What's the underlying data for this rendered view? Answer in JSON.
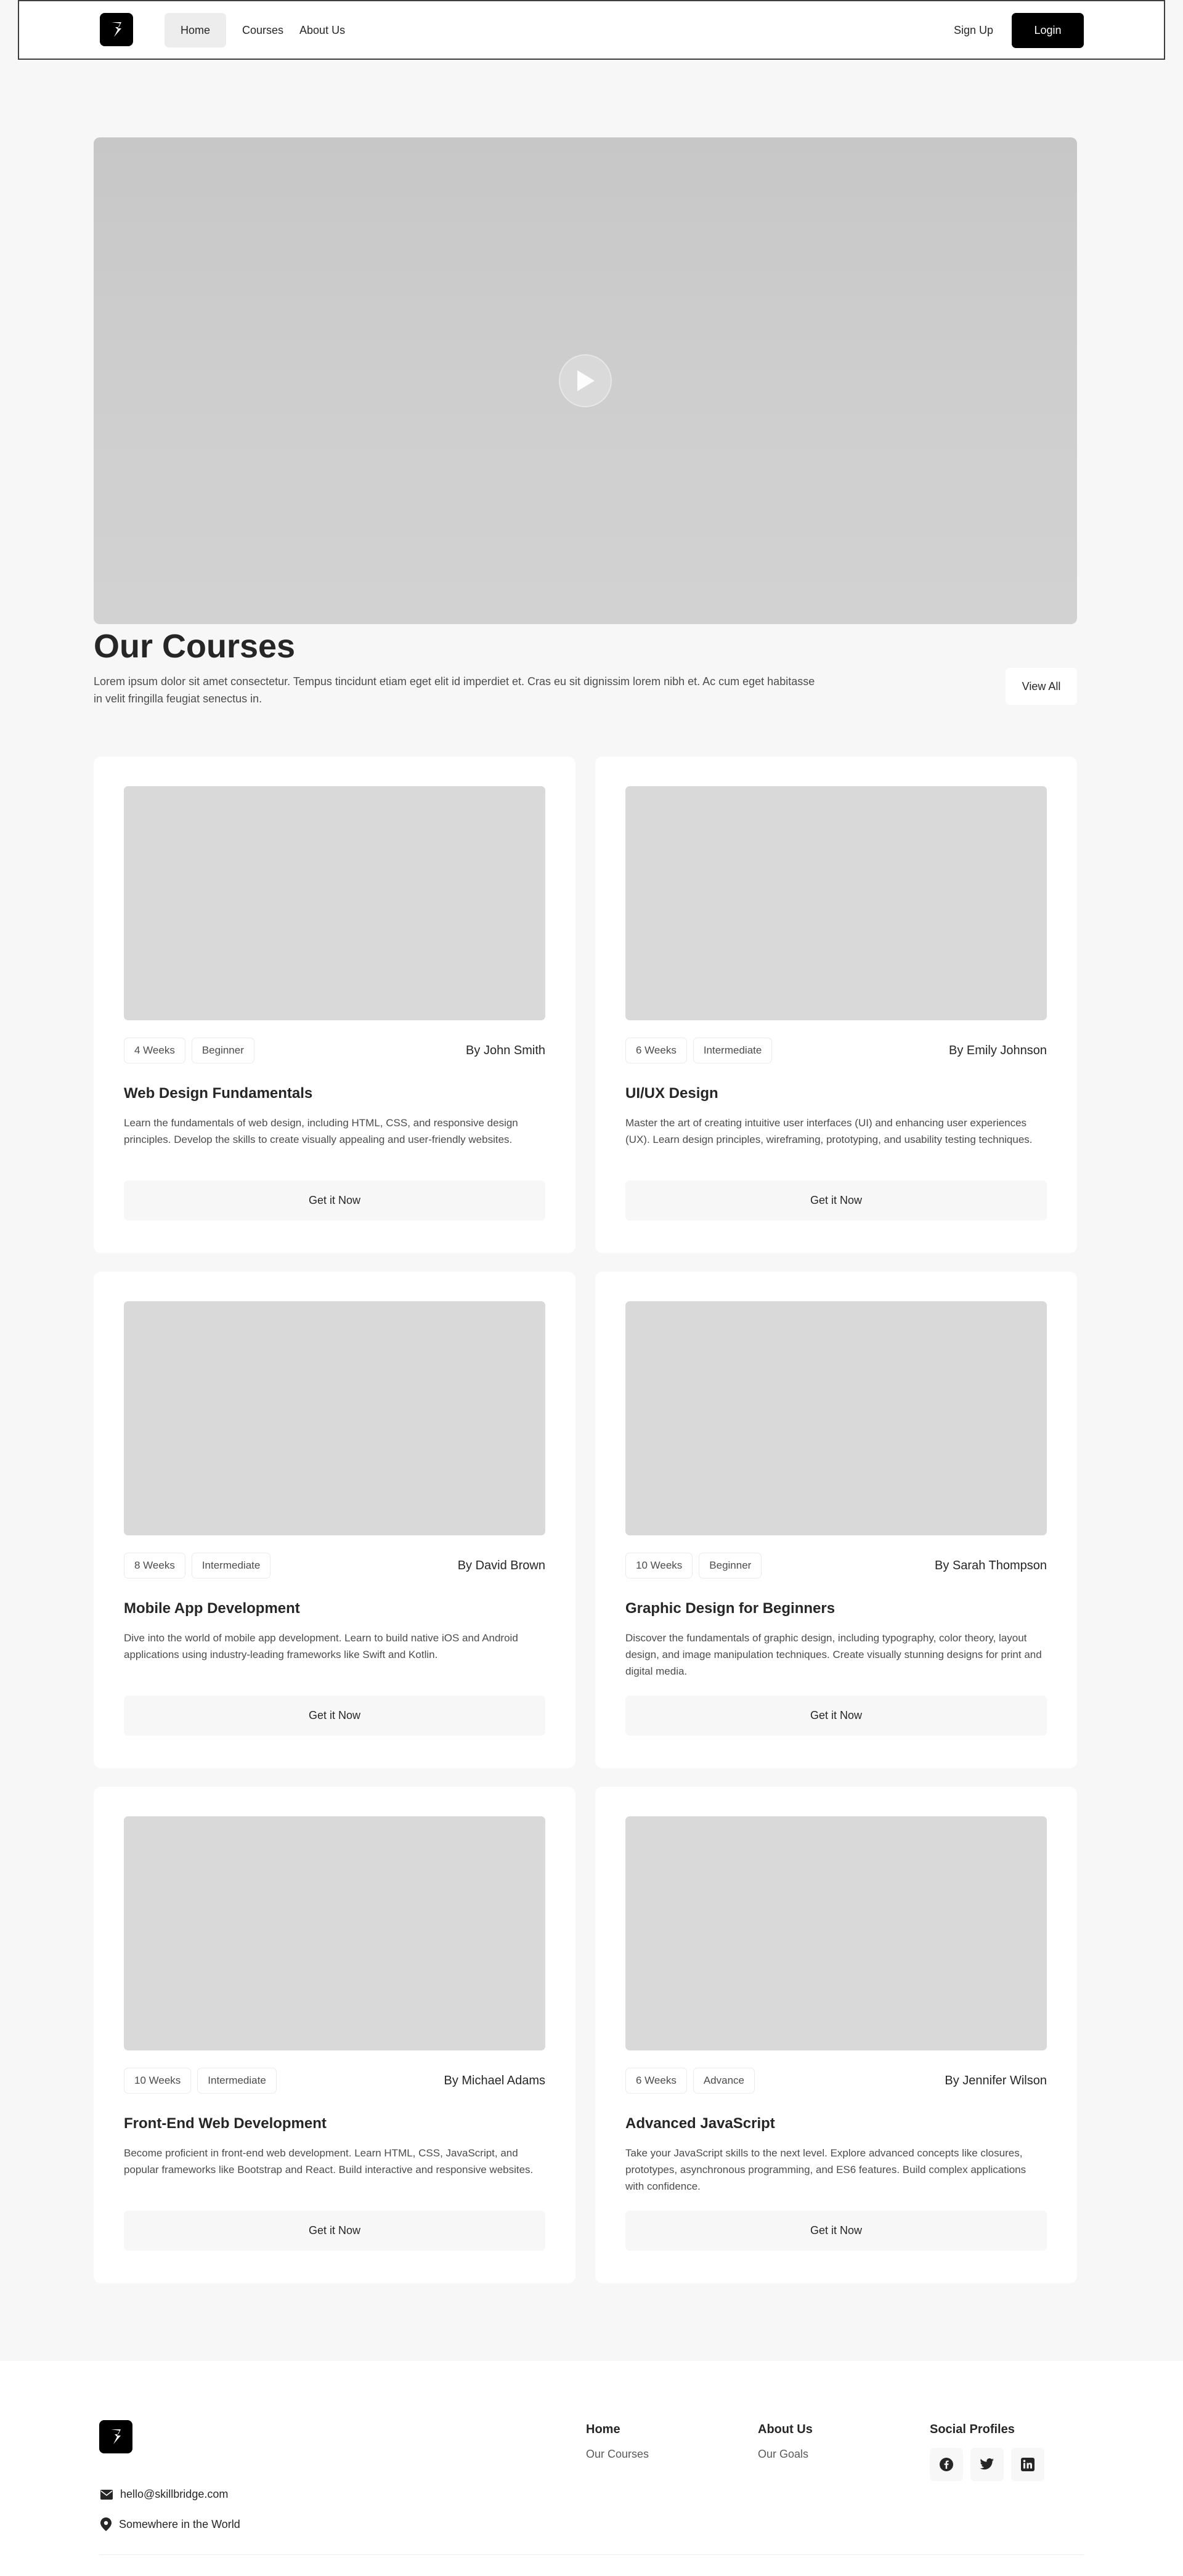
{
  "nav": {
    "links": [
      "Home",
      "Courses",
      "About Us"
    ],
    "signup": "Sign Up",
    "login": "Login"
  },
  "hero": {
    "play_icon": "play-icon"
  },
  "courses_section": {
    "title": "Our Courses",
    "description": "Lorem ipsum dolor sit amet consectetur. Tempus tincidunt etiam eget elit id imperdiet et. Cras eu sit dignissim lorem nibh et. Ac cum eget habitasse in velit fringilla feugiat senectus in.",
    "view_all": "View All"
  },
  "courses": [
    {
      "duration": "4 Weeks",
      "level": "Beginner",
      "author": "By John Smith",
      "title": "Web Design Fundamentals",
      "description": "Learn the fundamentals of web design, including HTML, CSS, and responsive design principles. Develop the skills to create visually appealing and user-friendly websites.",
      "cta": "Get it Now"
    },
    {
      "duration": "6 Weeks",
      "level": "Intermediate",
      "author": "By Emily Johnson",
      "title": "UI/UX Design",
      "description": "Master the art of creating intuitive user interfaces (UI) and enhancing user experiences (UX). Learn design principles, wireframing, prototyping, and usability testing techniques.",
      "cta": "Get it Now"
    },
    {
      "duration": "8 Weeks",
      "level": "Intermediate",
      "author": "By David Brown",
      "title": "Mobile App Development",
      "description": "Dive into the world of mobile app development. Learn to build native iOS and Android applications using industry-leading frameworks like Swift and Kotlin.",
      "cta": "Get it Now"
    },
    {
      "duration": "10 Weeks",
      "level": "Beginner",
      "author": "By Sarah Thompson",
      "title": "Graphic Design for Beginners",
      "description": "Discover the fundamentals of graphic design, including typography, color theory, layout design, and image manipulation techniques. Create visually stunning designs for print and digital media.",
      "cta": "Get it Now"
    },
    {
      "duration": "10 Weeks",
      "level": "Intermediate",
      "author": "By Michael Adams",
      "title": "Front-End Web Development",
      "description": "Become proficient in front-end web development. Learn HTML, CSS, JavaScript, and popular frameworks like Bootstrap and React. Build interactive and responsive websites.",
      "cta": "Get it Now"
    },
    {
      "duration": "6 Weeks",
      "level": "Advance",
      "author": "By Jennifer Wilson",
      "title": "Advanced JavaScript",
      "description": "Take your JavaScript skills to the next level. Explore advanced concepts like closures, prototypes, asynchronous programming, and ES6 features. Build complex applications with confidence.",
      "cta": "Get it Now"
    }
  ],
  "footer": {
    "email": "hello@skillbridge.com",
    "location": "Somewhere in the World",
    "col_home": {
      "title": "Home",
      "link": "Our Courses"
    },
    "col_about": {
      "title": "About Us",
      "link": "Our Goals"
    },
    "col_social": {
      "title": "Social Profiles",
      "icons": [
        "facebook-icon",
        "twitter-icon",
        "linkedin-icon"
      ]
    }
  },
  "colors": {
    "primary": "#000000",
    "background": "#f7f7f7",
    "card": "#ffffff",
    "placeholder": "#d9d9d9"
  }
}
